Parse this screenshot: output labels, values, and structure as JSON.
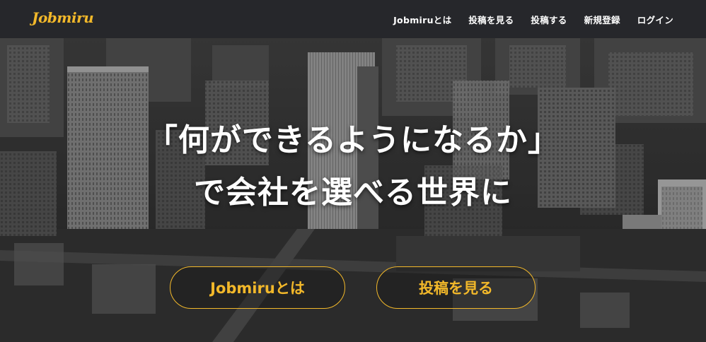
{
  "header": {
    "logo_text": "Jobmiru",
    "nav": [
      {
        "label": "Jobmiruとは"
      },
      {
        "label": "投稿を見る"
      },
      {
        "label": "投稿する"
      },
      {
        "label": "新規登録"
      },
      {
        "label": "ログイン"
      }
    ]
  },
  "hero": {
    "headline_line1": "「何ができるようになるか」",
    "headline_line2": "で会社を選べる世界に",
    "buttons": {
      "about_label": "Jobmiruとは",
      "posts_label": "投稿を見る"
    }
  },
  "colors": {
    "accent": "#f2b82a",
    "navbar_bg": "#26272b",
    "text": "#ffffff"
  }
}
